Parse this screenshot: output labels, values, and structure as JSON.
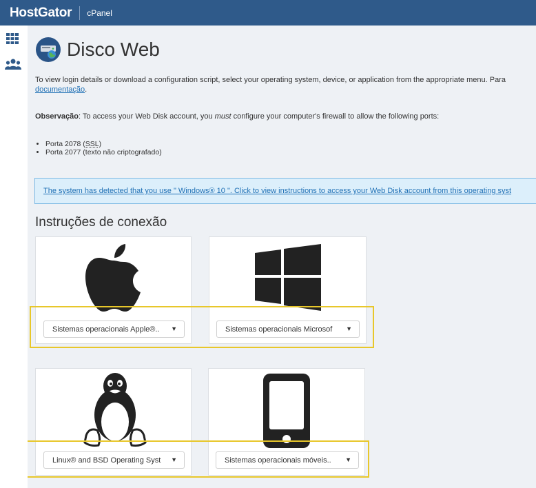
{
  "header": {
    "brand": "HostGator",
    "product": "cPanel"
  },
  "sidebar": {
    "items": [
      {
        "icon": "grid-icon"
      },
      {
        "icon": "users-icon"
      }
    ]
  },
  "page": {
    "title": "Disco Web",
    "intro_line1": "To view login details or download a configuration script, select your operating system, device, or application from the appropriate menu. Para",
    "intro_link": "documentação",
    "intro_end": ".",
    "note_label": "Observação",
    "note_text_1": ": To access your Web Disk account, you ",
    "note_emphasis": "must",
    "note_text_2": " configure your computer's firewall to allow the following ports:",
    "ports": [
      {
        "pre": "Porta 2078 (",
        "abbr": "SSL",
        "post": ")"
      },
      {
        "pre": "Porta 2077 (texto não criptografado)",
        "abbr": "",
        "post": ""
      }
    ],
    "detect_message": "The system has detected that you use \" Windows® 10 \". Click to view instructions to access your Web Disk account from this operating syst",
    "section_title": "Instruções de conexão"
  },
  "cards": [
    {
      "icon": "apple-icon",
      "select": "Sistemas operacionais Apple®.."
    },
    {
      "icon": "windows-icon",
      "select": "Sistemas operacionais Microsof"
    },
    {
      "icon": "linux-icon",
      "select": "Linux® and BSD Operating Syst"
    },
    {
      "icon": "mobile-icon",
      "select": "Sistemas operacionais móveis.."
    }
  ],
  "colors": {
    "topbar": "#2f5a8a",
    "highlight": "#e8c72a",
    "link": "#1f70b5",
    "info_bg": "#dceffb"
  }
}
